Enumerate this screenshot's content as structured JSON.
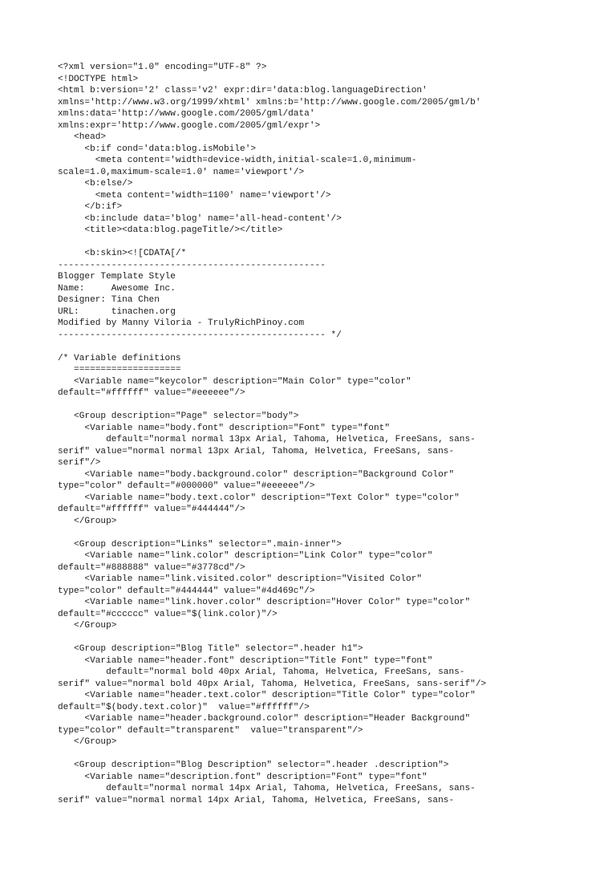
{
  "document": {
    "kind": "plain-text-source-listing",
    "language": "xml",
    "title": "Blogger Template Style",
    "template_name": "Awesome Inc.",
    "designer": "Tina Chen",
    "url": "tinachen.org",
    "modified_by": "Modified by Manny Viloria - TrulyRichPinoy.com",
    "background_color": "#ffffff",
    "text_color": "#1a1a1a"
  },
  "code": {
    "lines": [
      "<?xml version=\"1.0\" encoding=\"UTF-8\" ?>",
      "<!DOCTYPE html>",
      "<html b:version='2' class='v2' expr:dir='data:blog.languageDirection'",
      "xmlns='http://www.w3.org/1999/xhtml' xmlns:b='http://www.google.com/2005/gml/b'",
      "xmlns:data='http://www.google.com/2005/gml/data'",
      "xmlns:expr='http://www.google.com/2005/gml/expr'>",
      "   <head>",
      "     <b:if cond='data:blog.isMobile'>",
      "       <meta content='width=device-width,initial-scale=1.0,minimum-",
      "scale=1.0,maximum-scale=1.0' name='viewport'/>",
      "     <b:else/>",
      "       <meta content='width=1100' name='viewport'/>",
      "     </b:if>",
      "     <b:include data='blog' name='all-head-content'/>",
      "     <title><data:blog.pageTitle/></title>",
      "",
      "     <b:skin><![CDATA[/*",
      "--------------------------------------------------",
      "Blogger Template Style",
      "Name:     Awesome Inc.",
      "Designer: Tina Chen",
      "URL:      tinachen.org",
      "Modified by Manny Viloria - TrulyRichPinoy.com",
      "-------------------------------------------------- */",
      "",
      "/* Variable definitions",
      "   ====================",
      "   <Variable name=\"keycolor\" description=\"Main Color\" type=\"color\"",
      "default=\"#ffffff\" value=\"#eeeeee\"/>",
      "",
      "   <Group description=\"Page\" selector=\"body\">",
      "     <Variable name=\"body.font\" description=\"Font\" type=\"font\"",
      "         default=\"normal normal 13px Arial, Tahoma, Helvetica, FreeSans, sans-",
      "serif\" value=\"normal normal 13px Arial, Tahoma, Helvetica, FreeSans, sans-",
      "serif\"/>",
      "     <Variable name=\"body.background.color\" description=\"Background Color\"",
      "type=\"color\" default=\"#000000\" value=\"#eeeeee\"/>",
      "     <Variable name=\"body.text.color\" description=\"Text Color\" type=\"color\"",
      "default=\"#ffffff\" value=\"#444444\"/>",
      "   </Group>",
      "",
      "   <Group description=\"Links\" selector=\".main-inner\">",
      "     <Variable name=\"link.color\" description=\"Link Color\" type=\"color\"",
      "default=\"#888888\" value=\"#3778cd\"/>",
      "     <Variable name=\"link.visited.color\" description=\"Visited Color\"",
      "type=\"color\" default=\"#444444\" value=\"#4d469c\"/>",
      "     <Variable name=\"link.hover.color\" description=\"Hover Color\" type=\"color\"",
      "default=\"#cccccc\" value=\"$(link.color)\"/>",
      "   </Group>",
      "",
      "   <Group description=\"Blog Title\" selector=\".header h1\">",
      "     <Variable name=\"header.font\" description=\"Title Font\" type=\"font\"",
      "         default=\"normal bold 40px Arial, Tahoma, Helvetica, FreeSans, sans-",
      "serif\" value=\"normal bold 40px Arial, Tahoma, Helvetica, FreeSans, sans-serif\"/>",
      "     <Variable name=\"header.text.color\" description=\"Title Color\" type=\"color\"",
      "default=\"$(body.text.color)\"  value=\"#ffffff\"/>",
      "     <Variable name=\"header.background.color\" description=\"Header Background\"",
      "type=\"color\" default=\"transparent\"  value=\"transparent\"/>",
      "   </Group>",
      "",
      "   <Group description=\"Blog Description\" selector=\".header .description\">",
      "     <Variable name=\"description.font\" description=\"Font\" type=\"font\"",
      "         default=\"normal normal 14px Arial, Tahoma, Helvetica, FreeSans, sans-",
      "serif\" value=\"normal normal 14px Arial, Tahoma, Helvetica, FreeSans, sans-"
    ]
  }
}
